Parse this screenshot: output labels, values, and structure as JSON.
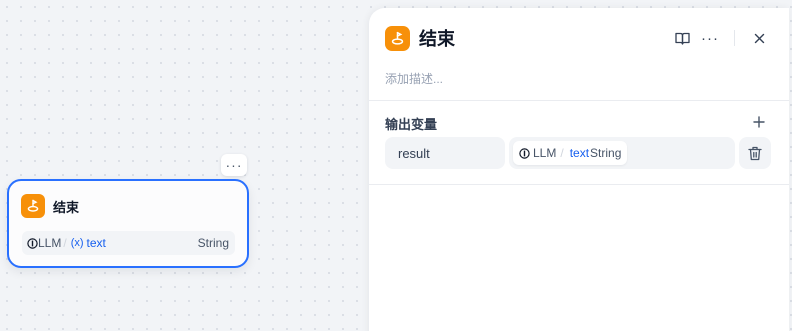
{
  "canvas": {
    "node_menu_label": "···",
    "node": {
      "title": "结束",
      "icon": "end-node-icon",
      "variable": {
        "source": "LLM",
        "separator": "/",
        "var_symbol": "(x)",
        "var_name": "text",
        "type": "String"
      }
    }
  },
  "panel": {
    "title": "结束",
    "icon": "end-node-icon",
    "toolbar": {
      "more_label": "···"
    },
    "description_placeholder": "添加描述...",
    "output_section": {
      "title": "输出变量",
      "rows": [
        {
          "name": "result",
          "source": "LLM",
          "separator": "/",
          "var_name": "text",
          "type": "String"
        }
      ]
    }
  },
  "colors": {
    "accent": "#2970ff",
    "brand_icon": "#f79009",
    "var_blue": "#155eef"
  }
}
